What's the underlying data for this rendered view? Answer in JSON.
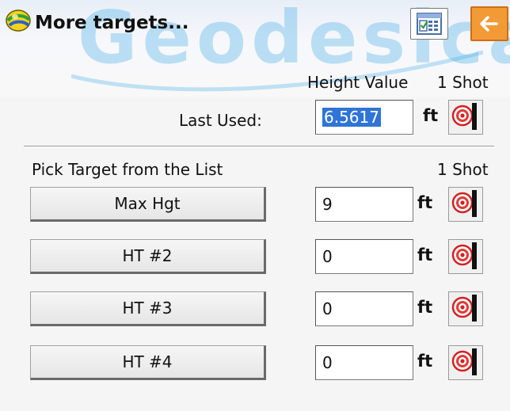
{
  "window": {
    "title": "More targets...",
    "watermark": "Geodesical"
  },
  "toolbar": {
    "calculator_icon": "calculator-icon",
    "back_icon": "back-arrow-icon",
    "back_color": "#f29a36"
  },
  "columns": {
    "height_value": "Height Value",
    "shot_top": "1 Shot",
    "shot_list": "1 Shot"
  },
  "last_used": {
    "label": "Last Used:",
    "value": "6.5617",
    "unit": "ft"
  },
  "list_heading": "Pick Target from the List",
  "targets": [
    {
      "name": "Max Hgt",
      "value": "9",
      "unit": "ft"
    },
    {
      "name": "HT #2",
      "value": "0",
      "unit": "ft"
    },
    {
      "name": "HT #3",
      "value": "0",
      "unit": "ft"
    },
    {
      "name": "HT #4",
      "value": "0",
      "unit": "ft"
    }
  ]
}
